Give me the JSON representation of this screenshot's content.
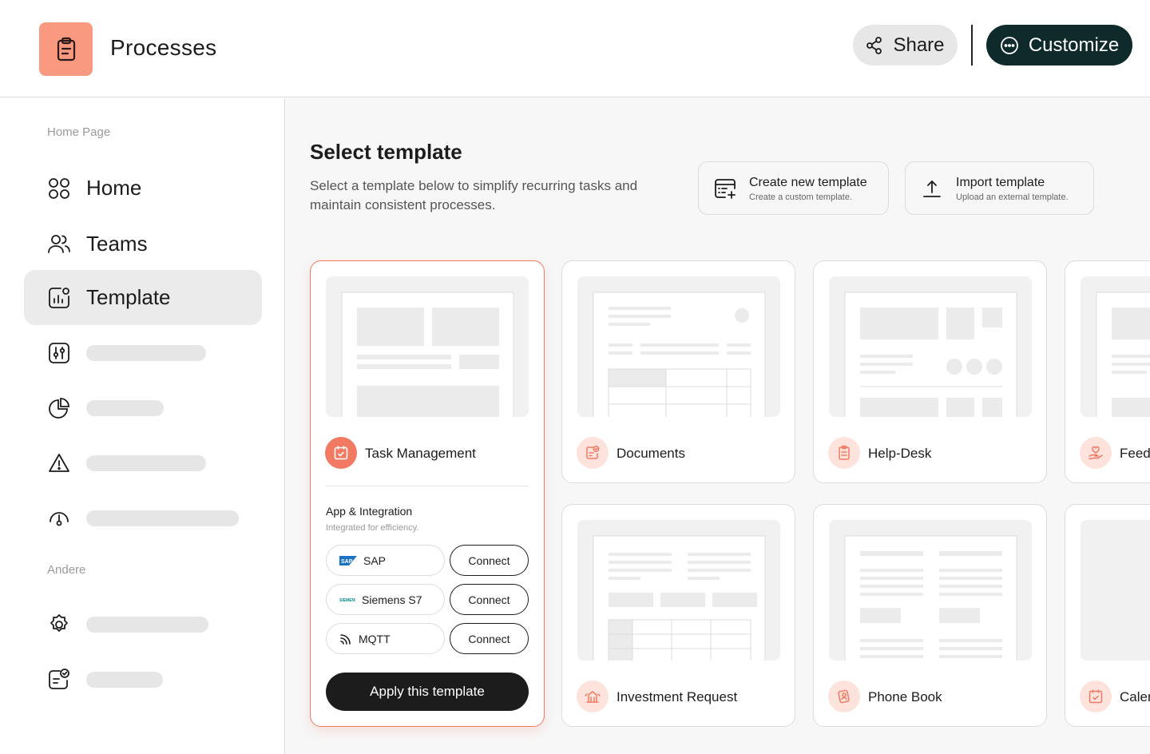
{
  "header": {
    "app_title": "Processes",
    "share_label": "Share",
    "customize_label": "Customize"
  },
  "sidebar": {
    "section_home": "Home Page",
    "section_other": "Andere",
    "items": [
      {
        "label": "Home",
        "icon": "grid-icon"
      },
      {
        "label": "Teams",
        "icon": "users-icon"
      },
      {
        "label": "Template",
        "icon": "chart-doc-icon",
        "active": true
      }
    ],
    "placeholder_icons": [
      "sliders-icon",
      "pie-chart-icon",
      "warning-icon",
      "gauge-icon",
      "settings-icon",
      "checklist-icon"
    ]
  },
  "main": {
    "title": "Select template",
    "subtitle": "Select a template below to simplify recurring tasks and maintain consistent processes.",
    "actions": [
      {
        "title": "Create new template",
        "sub": "Create a custom template."
      },
      {
        "title": "Import template",
        "sub": "Upload an external template."
      }
    ],
    "templates": [
      {
        "name": "Task Management",
        "icon": "calendar-check-icon"
      },
      {
        "name": "Documents",
        "icon": "document-check-icon"
      },
      {
        "name": "Help-Desk",
        "icon": "clipboard-list-icon"
      },
      {
        "name": "Feedb",
        "icon": "heart-hand-icon"
      },
      {
        "name": "Investment Request",
        "icon": "building-icon"
      },
      {
        "name": "Phone Book",
        "icon": "contacts-icon"
      },
      {
        "name": "Calen",
        "icon": "calendar-icon"
      }
    ],
    "integration": {
      "title": "App & Integration",
      "subtitle": "Integrated for efficiency.",
      "items": [
        {
          "name": "SAP",
          "logo": "SAP",
          "button": "Connect"
        },
        {
          "name": "Siemens S7",
          "logo": "SIEMENS",
          "button": "Connect"
        },
        {
          "name": "MQTT",
          "button": "Connect"
        }
      ]
    },
    "apply_label": "Apply this template"
  },
  "colors": {
    "accent": "#f27a63",
    "accent_light": "#fde3dc",
    "dark": "#0e2a2b",
    "logo_bg": "#f99a80"
  }
}
